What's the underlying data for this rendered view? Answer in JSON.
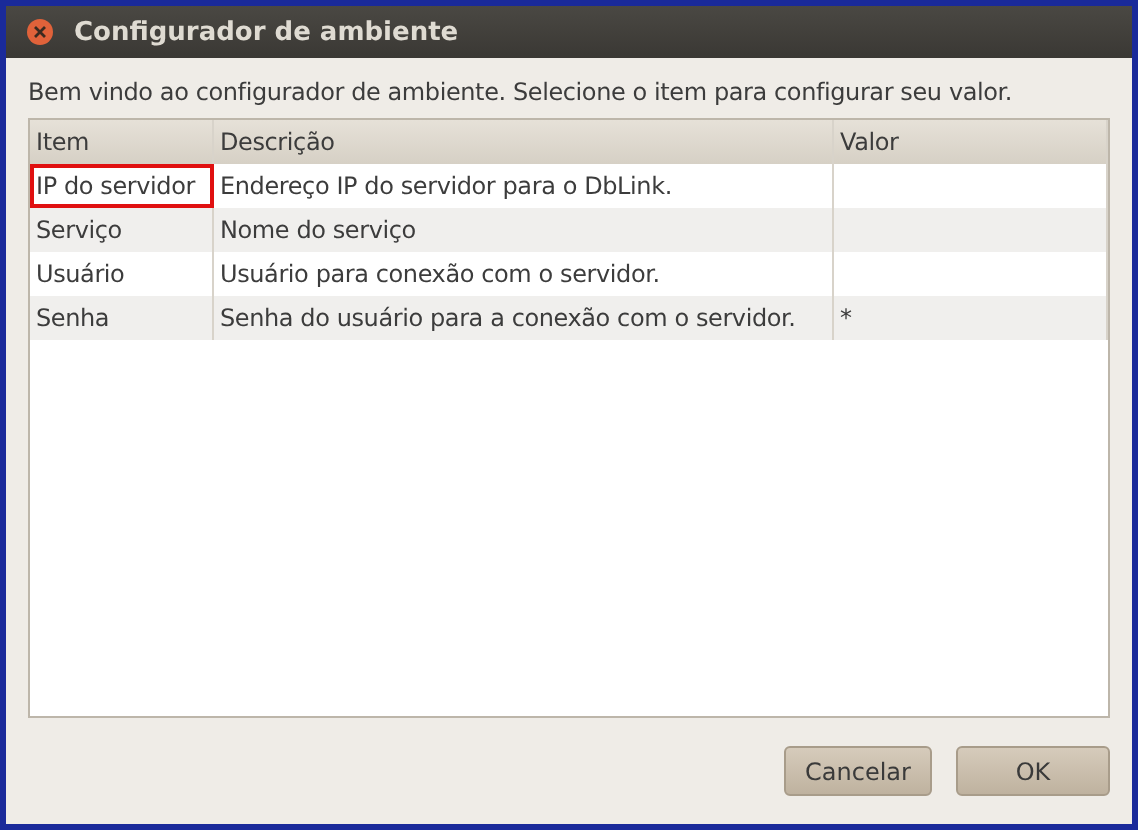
{
  "window": {
    "title": "Configurador de ambiente"
  },
  "intro": "Bem vindo ao configurador de ambiente. Selecione o item para configurar seu valor.",
  "table": {
    "columns": [
      "Item",
      "Descrição",
      "Valor"
    ],
    "rows": [
      {
        "item": "IP do servidor",
        "description": "Endereço IP do servidor para o DbLink.",
        "highlighted": true
      },
      {
        "item": "Serviço",
        "description": "Nome do serviço",
        "highlighted": false
      },
      {
        "item": "Usuário",
        "description": "Usuário para conexão com o servidor.",
        "highlighted": false
      },
      {
        "item": "Senha",
        "description": "Senha do usuário para a conexão com o servidor.",
        "value": "*",
        "highlighted": false
      }
    ]
  },
  "buttons": [
    {
      "label": "Cancelar",
      "kind": "cancel"
    },
    {
      "label": "OK",
      "kind": "ok"
    }
  ]
}
